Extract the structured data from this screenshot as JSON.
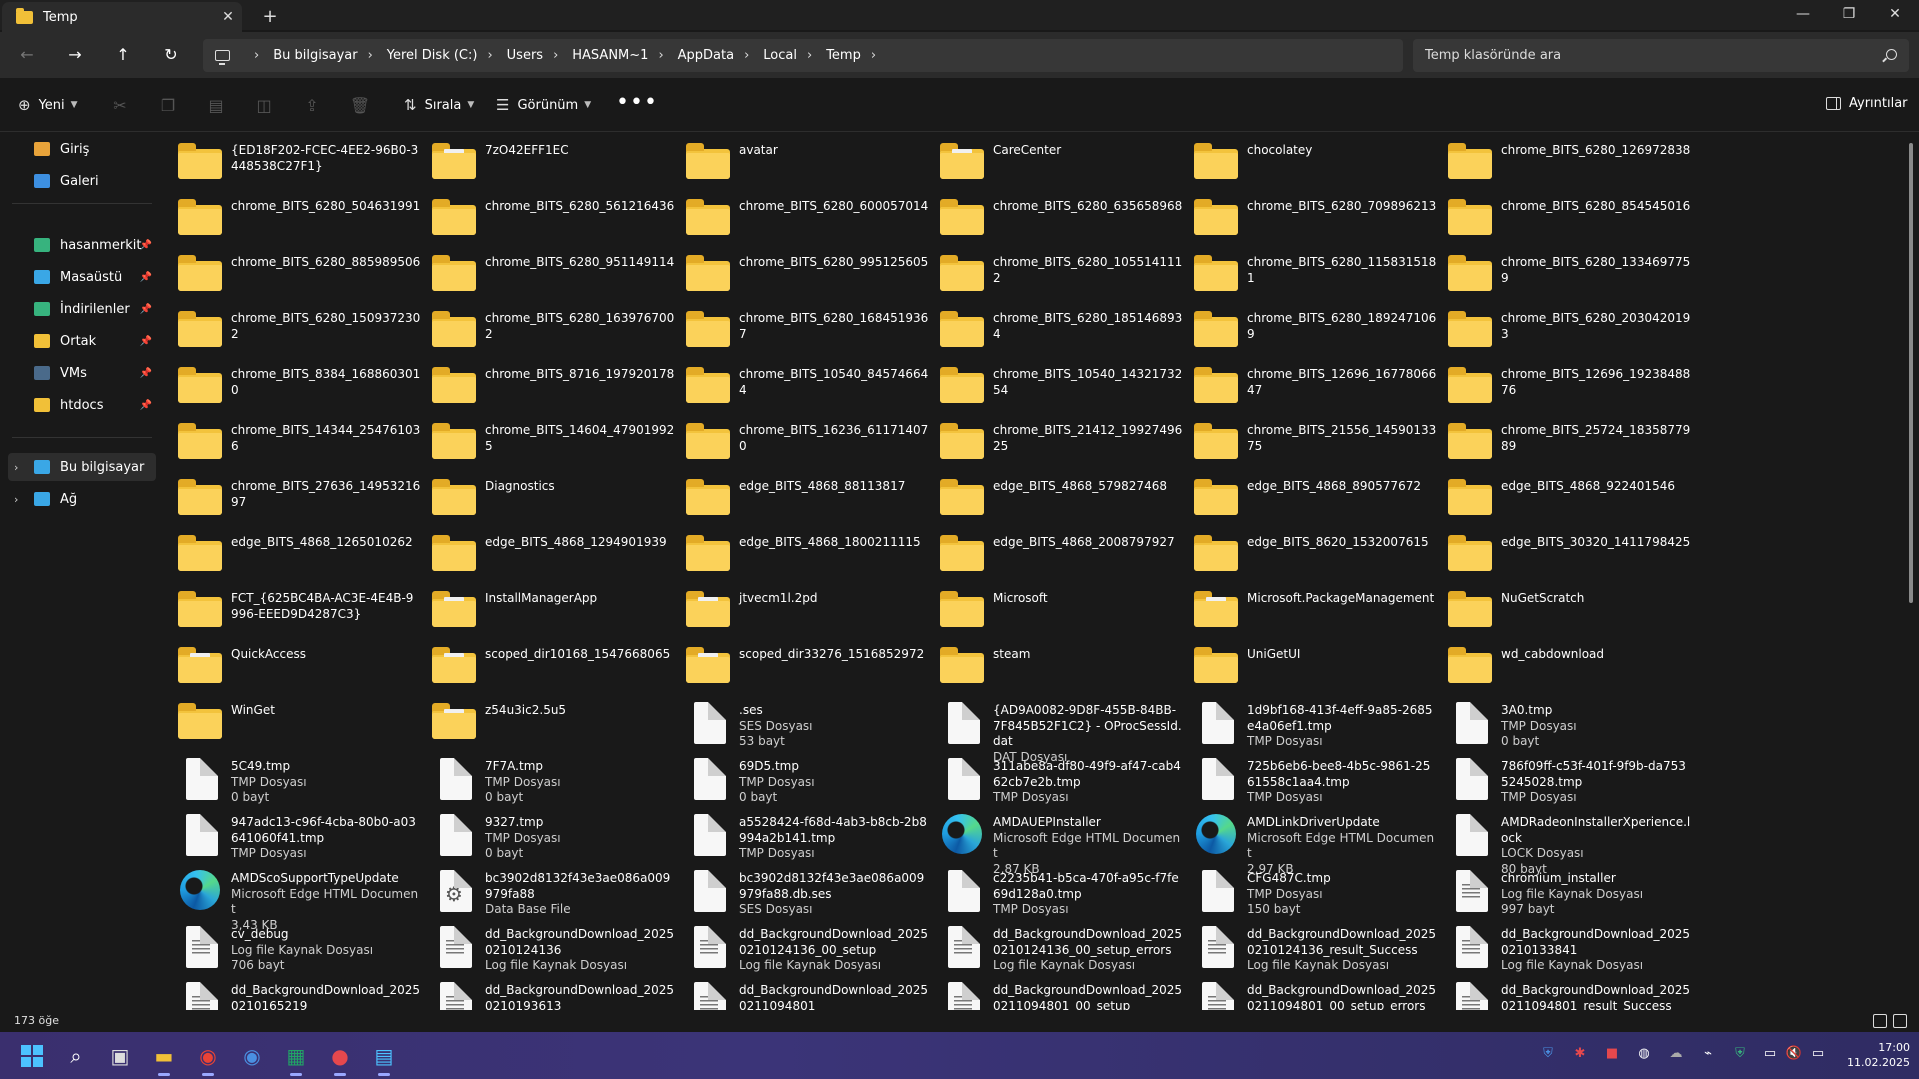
{
  "window": {
    "tab_title": "Temp",
    "tab_close": "✕",
    "new_tab": "+",
    "minimize": "—",
    "maximize": "❐",
    "close": "✕"
  },
  "nav": {
    "back": "←",
    "forward": "→",
    "up": "↑",
    "refresh": "↻",
    "breadcrumbs": [
      "Bu bilgisayar",
      "Yerel Disk (C:)",
      "Users",
      "HASANM~1",
      "AppData",
      "Local",
      "Temp"
    ],
    "search_placeholder": "Temp klasöründe ara"
  },
  "commands": {
    "new": "Yeni",
    "sort": "Sırala",
    "view": "Görünüm",
    "more": "•••",
    "details": "Ayrıntılar"
  },
  "sidebar": {
    "top": [
      {
        "label": "Giriş",
        "color": "#e8a33a"
      },
      {
        "label": "Galeri",
        "color": "#3d8fe0"
      }
    ],
    "pinned": [
      {
        "label": "hasanmerkit",
        "color": "#37b37e"
      },
      {
        "label": "Masaüstü",
        "color": "#3aa7e6"
      },
      {
        "label": "İndirilenler",
        "color": "#37b37e"
      },
      {
        "label": "Ortak",
        "color": "#f1c038"
      },
      {
        "label": "VMs",
        "color": "#4a6a8a"
      },
      {
        "label": "htdocs",
        "color": "#f1c038"
      }
    ],
    "bottom": [
      {
        "label": "Bu bilgisayar",
        "color": "#3aa7e6",
        "selected": true
      },
      {
        "label": "Ağ",
        "color": "#3aa7e6",
        "selected": false
      }
    ]
  },
  "items": [
    {
      "type": "folder",
      "name": "{ED18F202-FCEC-4EE2-96B0-3448538C27F1}"
    },
    {
      "type": "folder-paper",
      "name": "7zO42EFF1EC"
    },
    {
      "type": "folder",
      "name": "avatar"
    },
    {
      "type": "folder-paper",
      "name": "CareCenter"
    },
    {
      "type": "folder",
      "name": "chocolatey"
    },
    {
      "type": "folder",
      "name": "chrome_BITS_6280_126972838"
    },
    {
      "type": "folder",
      "name": "chrome_BITS_6280_504631991"
    },
    {
      "type": "folder",
      "name": "chrome_BITS_6280_561216436"
    },
    {
      "type": "folder",
      "name": "chrome_BITS_6280_600057014"
    },
    {
      "type": "folder",
      "name": "chrome_BITS_6280_635658968"
    },
    {
      "type": "folder",
      "name": "chrome_BITS_6280_709896213"
    },
    {
      "type": "folder",
      "name": "chrome_BITS_6280_854545016"
    },
    {
      "type": "folder",
      "name": "chrome_BITS_6280_885989506"
    },
    {
      "type": "folder",
      "name": "chrome_BITS_6280_951149114"
    },
    {
      "type": "folder",
      "name": "chrome_BITS_6280_995125605"
    },
    {
      "type": "folder",
      "name": "chrome_BITS_6280_1055141112"
    },
    {
      "type": "folder",
      "name": "chrome_BITS_6280_1158315181"
    },
    {
      "type": "folder",
      "name": "chrome_BITS_6280_1334697759"
    },
    {
      "type": "folder",
      "name": "chrome_BITS_6280_1509372302"
    },
    {
      "type": "folder",
      "name": "chrome_BITS_6280_1639767002"
    },
    {
      "type": "folder",
      "name": "chrome_BITS_6280_1684519367"
    },
    {
      "type": "folder",
      "name": "chrome_BITS_6280_1851468934"
    },
    {
      "type": "folder",
      "name": "chrome_BITS_6280_1892471069"
    },
    {
      "type": "folder",
      "name": "chrome_BITS_6280_2030420193"
    },
    {
      "type": "folder",
      "name": "chrome_BITS_8384_1688603010"
    },
    {
      "type": "folder",
      "name": "chrome_BITS_8716_197920178"
    },
    {
      "type": "folder",
      "name": "chrome_BITS_10540_845746644"
    },
    {
      "type": "folder",
      "name": "chrome_BITS_10540_1432173254"
    },
    {
      "type": "folder",
      "name": "chrome_BITS_12696_1677806647"
    },
    {
      "type": "folder",
      "name": "chrome_BITS_12696_1923848876"
    },
    {
      "type": "folder",
      "name": "chrome_BITS_14344_254761036"
    },
    {
      "type": "folder",
      "name": "chrome_BITS_14604_479019925"
    },
    {
      "type": "folder",
      "name": "chrome_BITS_16236_611714070"
    },
    {
      "type": "folder",
      "name": "chrome_BITS_21412_1992749625"
    },
    {
      "type": "folder",
      "name": "chrome_BITS_21556_1459013375"
    },
    {
      "type": "folder",
      "name": "chrome_BITS_25724_1835877989"
    },
    {
      "type": "folder",
      "name": "chrome_BITS_27636_1495321697"
    },
    {
      "type": "folder",
      "name": "Diagnostics"
    },
    {
      "type": "folder",
      "name": "edge_BITS_4868_88113817"
    },
    {
      "type": "folder",
      "name": "edge_BITS_4868_579827468"
    },
    {
      "type": "folder",
      "name": "edge_BITS_4868_890577672"
    },
    {
      "type": "folder",
      "name": "edge_BITS_4868_922401546"
    },
    {
      "type": "folder",
      "name": "edge_BITS_4868_1265010262"
    },
    {
      "type": "folder",
      "name": "edge_BITS_4868_1294901939"
    },
    {
      "type": "folder",
      "name": "edge_BITS_4868_1800211115"
    },
    {
      "type": "folder",
      "name": "edge_BITS_4868_2008797927"
    },
    {
      "type": "folder",
      "name": "edge_BITS_8620_1532007615"
    },
    {
      "type": "folder",
      "name": "edge_BITS_30320_1411798425"
    },
    {
      "type": "folder",
      "name": "FCT_{625BC4BA-AC3E-4E4B-9996-EEED9D4287C3}"
    },
    {
      "type": "folder-paper",
      "name": "InstallManagerApp"
    },
    {
      "type": "folder-paper",
      "name": "jtvecm1l.2pd"
    },
    {
      "type": "folder",
      "name": "Microsoft"
    },
    {
      "type": "folder-paper",
      "name": "Microsoft.PackageManagement"
    },
    {
      "type": "folder",
      "name": "NuGetScratch"
    },
    {
      "type": "folder-paper",
      "name": "QuickAccess"
    },
    {
      "type": "folder-paper",
      "name": "scoped_dir10168_1547668065"
    },
    {
      "type": "folder-paper",
      "name": "scoped_dir33276_1516852972"
    },
    {
      "type": "folder",
      "name": "steam"
    },
    {
      "type": "folder",
      "name": "UniGetUI"
    },
    {
      "type": "folder",
      "name": "wd_cabdownload"
    },
    {
      "type": "folder",
      "name": "WinGet"
    },
    {
      "type": "folder-paper",
      "name": "z54u3ic2.5u5"
    },
    {
      "type": "file",
      "name": ".ses",
      "kind": "SES Dosyası",
      "size": "53 bayt"
    },
    {
      "type": "file",
      "name": "{AD9A0082-9D8F-455B-84BB-7F845B52F1C2} - OProcSessId.dat",
      "kind": "DAT Dosyası",
      "size": ""
    },
    {
      "type": "file",
      "name": "1d9bf168-413f-4eff-9a85-2685e4a06ef1.tmp",
      "kind": "TMP Dosyası",
      "size": ""
    },
    {
      "type": "file",
      "name": "3A0.tmp",
      "kind": "TMP Dosyası",
      "size": "0 bayt"
    },
    {
      "type": "file",
      "name": "5C49.tmp",
      "kind": "TMP Dosyası",
      "size": "0 bayt"
    },
    {
      "type": "file",
      "name": "7F7A.tmp",
      "kind": "TMP Dosyası",
      "size": "0 bayt"
    },
    {
      "type": "file",
      "name": "69D5.tmp",
      "kind": "TMP Dosyası",
      "size": "0 bayt"
    },
    {
      "type": "file",
      "name": "311abe8a-df80-49f9-af47-cab462cb7e2b.tmp",
      "kind": "TMP Dosyası",
      "size": ""
    },
    {
      "type": "file",
      "name": "725b6eb6-bee8-4b5c-9861-2561558c1aa4.tmp",
      "kind": "TMP Dosyası",
      "size": ""
    },
    {
      "type": "file",
      "name": "786f09ff-c53f-401f-9f9b-da7535245028.tmp",
      "kind": "TMP Dosyası",
      "size": ""
    },
    {
      "type": "file",
      "name": "947adc13-c96f-4cba-80b0-a03641060f41.tmp",
      "kind": "TMP Dosyası",
      "size": ""
    },
    {
      "type": "file",
      "name": "9327.tmp",
      "kind": "TMP Dosyası",
      "size": "0 bayt"
    },
    {
      "type": "file",
      "name": "a5528424-f68d-4ab3-b8cb-2b8994a2b141.tmp",
      "kind": "TMP Dosyası",
      "size": ""
    },
    {
      "type": "edge",
      "name": "AMDAUEPInstaller",
      "kind": "Microsoft Edge HTML Document",
      "size": "2,87 KB"
    },
    {
      "type": "edge",
      "name": "AMDLinkDriverUpdate",
      "kind": "Microsoft Edge HTML Document",
      "size": "2,97 KB"
    },
    {
      "type": "file",
      "name": "AMDRadeonInstallerXperience.lock",
      "kind": "LOCK Dosyası",
      "size": "80 bayt"
    },
    {
      "type": "edge",
      "name": "AMDScoSupportTypeUpdate",
      "kind": "Microsoft Edge HTML Document",
      "size": "3,43 KB"
    },
    {
      "type": "gear",
      "name": "bc3902d8132f43e3ae086a009979fa88",
      "kind": "Data Base File",
      "size": ""
    },
    {
      "type": "file",
      "name": "bc3902d8132f43e3ae086a009979fa88.db.ses",
      "kind": "SES Dosyası",
      "size": ""
    },
    {
      "type": "file",
      "name": "c2235b41-b5ca-470f-a95c-f7fe69d128a0.tmp",
      "kind": "TMP Dosyası",
      "size": ""
    },
    {
      "type": "file",
      "name": "CFG487C.tmp",
      "kind": "TMP Dosyası",
      "size": "150 bayt"
    },
    {
      "type": "log",
      "name": "chromium_installer",
      "kind": "Log file Kaynak Dosyası",
      "size": "997 bayt"
    },
    {
      "type": "log",
      "name": "cv_debug",
      "kind": "Log file Kaynak Dosyası",
      "size": "706 bayt"
    },
    {
      "type": "log",
      "name": "dd_BackgroundDownload_20250210124136",
      "kind": "Log file Kaynak Dosyası",
      "size": ""
    },
    {
      "type": "log",
      "name": "dd_BackgroundDownload_20250210124136_00_setup",
      "kind": "Log file Kaynak Dosyası",
      "size": ""
    },
    {
      "type": "log",
      "name": "dd_BackgroundDownload_20250210124136_00_setup_errors",
      "kind": "Log file Kaynak Dosyası",
      "size": ""
    },
    {
      "type": "log",
      "name": "dd_BackgroundDownload_20250210124136_result_Success",
      "kind": "Log file Kaynak Dosyası",
      "size": ""
    },
    {
      "type": "log",
      "name": "dd_BackgroundDownload_20250210133841",
      "kind": "Log file Kaynak Dosyası",
      "size": ""
    },
    {
      "type": "log",
      "name": "dd_BackgroundDownload_20250210165219",
      "kind": "",
      "size": ""
    },
    {
      "type": "log",
      "name": "dd_BackgroundDownload_20250210193613",
      "kind": "",
      "size": ""
    },
    {
      "type": "log",
      "name": "dd_BackgroundDownload_20250211094801",
      "kind": "",
      "size": ""
    },
    {
      "type": "log",
      "name": "dd_BackgroundDownload_20250211094801_00_setup",
      "kind": "",
      "size": ""
    },
    {
      "type": "log",
      "name": "dd_BackgroundDownload_20250211094801_00_setup_errors",
      "kind": "",
      "size": ""
    },
    {
      "type": "log",
      "name": "dd_BackgroundDownload_20250211094801_result_Success",
      "kind": "",
      "size": ""
    }
  ],
  "status": {
    "count": "173 öğe"
  },
  "taskbar": {
    "time": "17:00",
    "date": "11.02.2025",
    "apps": [
      "start-icon",
      "search-icon",
      "task-view-icon",
      "file-explorer-icon",
      "chrome-icon",
      "chrome-alt-icon",
      "excel-icon",
      "ccleaner-icon",
      "notepad-icon"
    ]
  }
}
